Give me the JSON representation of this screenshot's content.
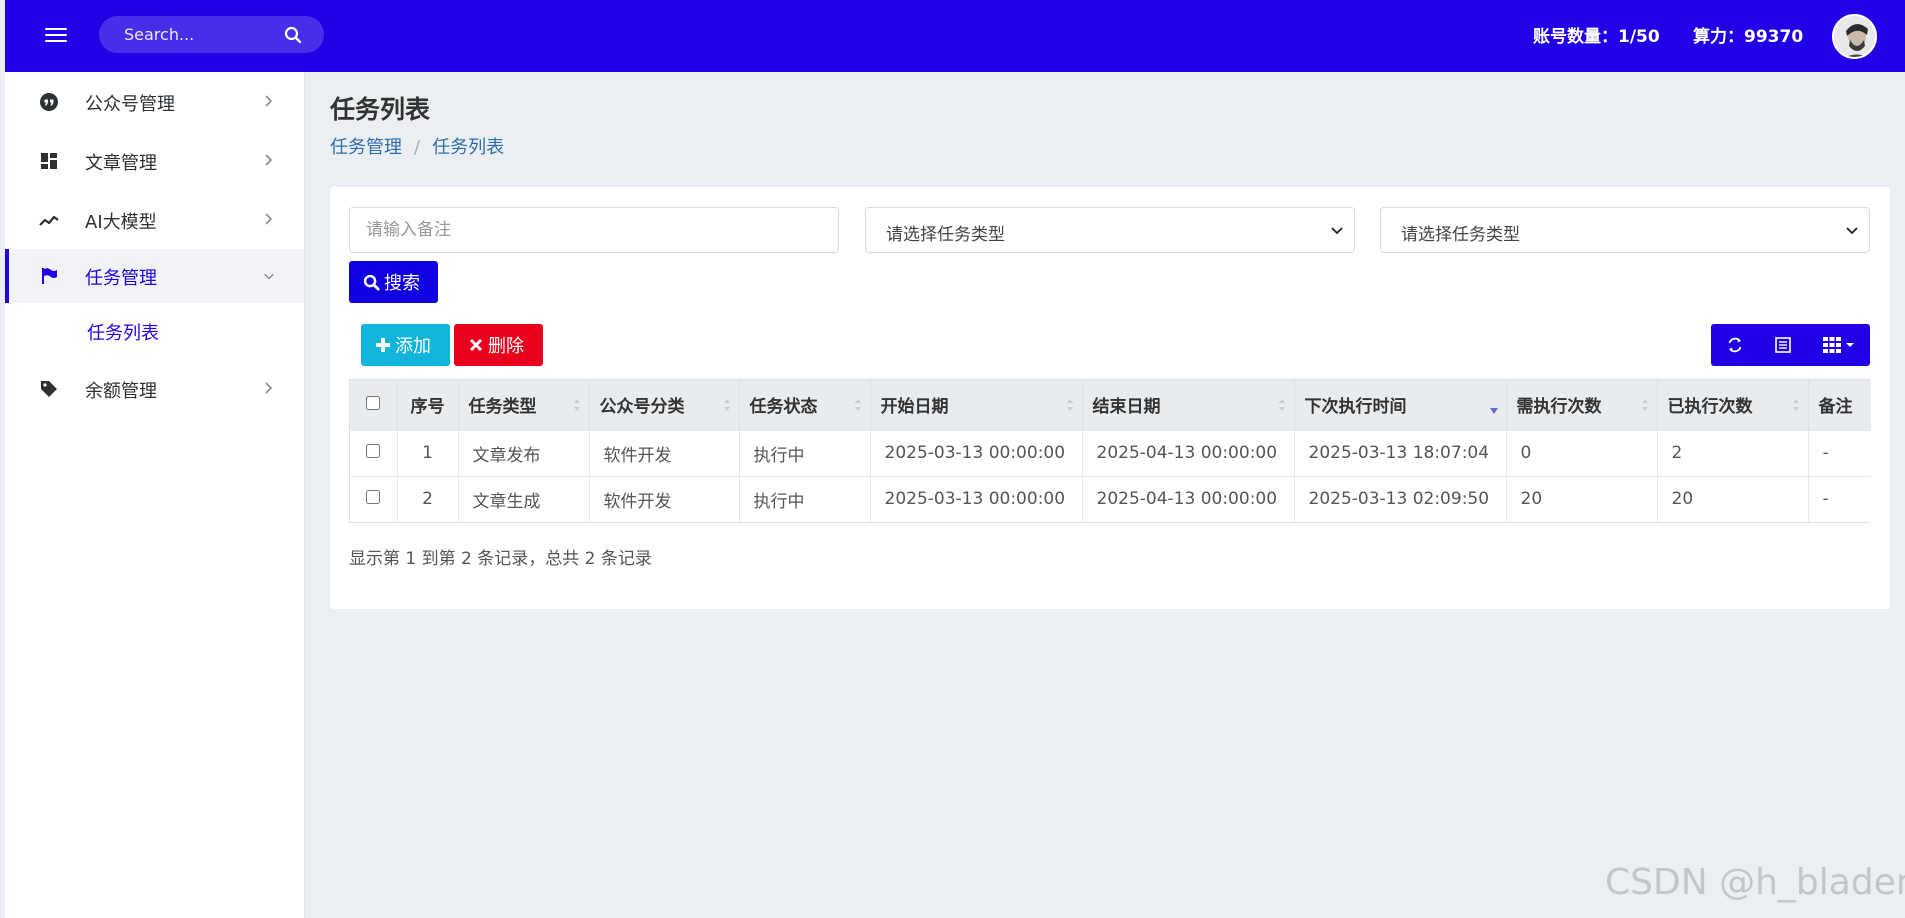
{
  "topbar": {
    "search_placeholder": "Search...",
    "accounts_label": "账号数量：1/50",
    "power_label": "算力：99370",
    "bg_color": "#2200e5"
  },
  "sidebar": {
    "items": [
      {
        "label": "公众号管理",
        "icon": "quote-icon"
      },
      {
        "label": "文章管理",
        "icon": "dashboard-icon"
      },
      {
        "label": "AI大模型",
        "icon": "line-chart-icon"
      },
      {
        "label": "任务管理",
        "icon": "flag-icon",
        "active": true,
        "children": [
          {
            "label": "任务列表"
          }
        ]
      },
      {
        "label": "余额管理",
        "icon": "tag-icon"
      }
    ]
  },
  "page": {
    "title": "任务列表",
    "breadcrumb": [
      "任务管理",
      "任务列表"
    ]
  },
  "filters": {
    "remark_placeholder": "请输入备注",
    "type_select_1": "请选择任务类型",
    "type_select_2": "请选择任务类型",
    "search_label": "搜索"
  },
  "toolbar": {
    "add_label": "添加",
    "delete_label": "删除"
  },
  "table": {
    "columns": [
      "序号",
      "任务类型",
      "公众号分类",
      "任务状态",
      "开始日期",
      "结束日期",
      "下次执行时间",
      "需执行次数",
      "已执行次数",
      "备注"
    ],
    "rows": [
      [
        "1",
        "文章发布",
        "软件开发",
        "执行中",
        "2025-03-13 00:00:00",
        "2025-04-13 00:00:00",
        "2025-03-13 18:07:04",
        "0",
        "2",
        "-"
      ],
      [
        "2",
        "文章生成",
        "软件开发",
        "执行中",
        "2025-03-13 00:00:00",
        "2025-04-13 00:00:00",
        "2025-03-13 02:09:50",
        "20",
        "20",
        "-"
      ]
    ]
  },
  "pagination": {
    "info": "显示第 1 到第 2 条记录，总共 2 条记录"
  },
  "watermark": "CSDN @h_bladem"
}
